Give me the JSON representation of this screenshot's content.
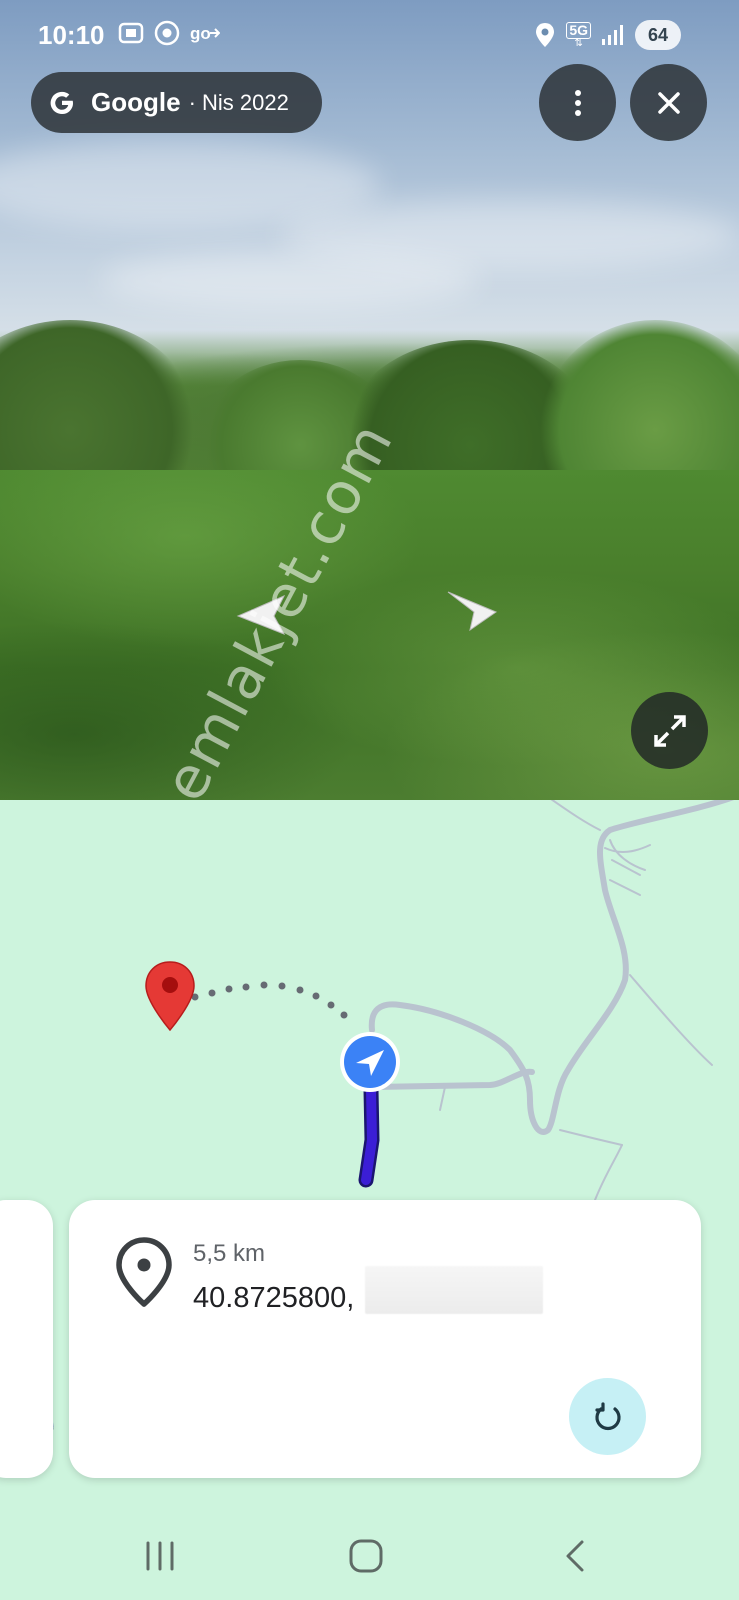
{
  "status_bar": {
    "time": "10:10",
    "network": "5G",
    "battery": "64"
  },
  "street_view": {
    "provider": "Google",
    "date": "· Nis 2022",
    "watermark": "emlakjet.com"
  },
  "location_card": {
    "distance": "5,5 km",
    "coordinates": "40.8725800,"
  },
  "colors": {
    "map_background": "#cdf4dd",
    "route": "#3b1ed6",
    "location_pin": "#e53935",
    "my_location": "#3b82f6",
    "refresh_button": "#c6f0f5"
  },
  "icons": {
    "menu": "more-vertical-icon",
    "close": "close-icon",
    "expand": "expand-icon",
    "pin": "location-pin-outline-icon",
    "refresh": "refresh-icon"
  }
}
